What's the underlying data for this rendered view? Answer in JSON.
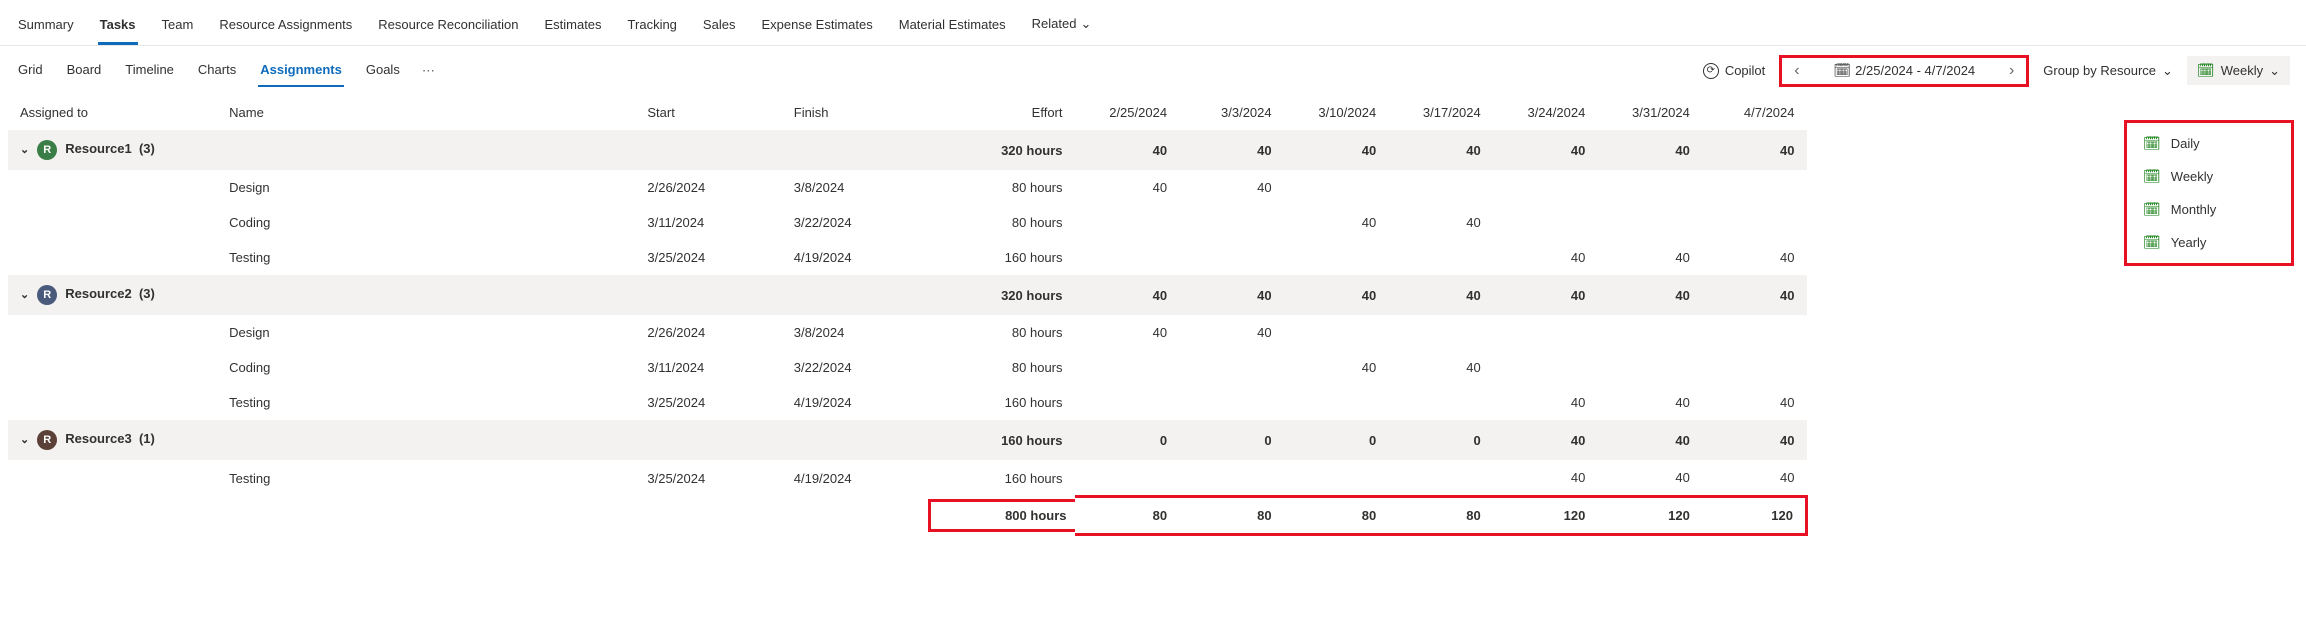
{
  "mainTabs": {
    "t0": "Summary",
    "t1": "Tasks",
    "t2": "Team",
    "t3": "Resource Assignments",
    "t4": "Resource Reconciliation",
    "t5": "Estimates",
    "t6": "Tracking",
    "t7": "Sales",
    "t8": "Expense Estimates",
    "t9": "Material Estimates",
    "t10": "Related"
  },
  "subTabs": {
    "s0": "Grid",
    "s1": "Board",
    "s2": "Timeline",
    "s3": "Charts",
    "s4": "Assignments",
    "s5": "Goals"
  },
  "toolbar": {
    "copilot": "Copilot",
    "dateRange": "2/25/2024 - 4/7/2024",
    "groupBy": "Group by Resource",
    "timescale": "Weekly"
  },
  "timescaleMenu": {
    "m0": "Daily",
    "m1": "Weekly",
    "m2": "Monthly",
    "m3": "Yearly"
  },
  "columns": {
    "assigned": "Assigned to",
    "name": "Name",
    "start": "Start",
    "finish": "Finish",
    "effort": "Effort",
    "w0": "2/25/2024",
    "w1": "3/3/2024",
    "w2": "3/10/2024",
    "w3": "3/17/2024",
    "w4": "3/24/2024",
    "w5": "3/31/2024",
    "w6": "4/7/2024"
  },
  "groups": [
    {
      "id": "r1",
      "label": "Resource1",
      "count": "(3)",
      "avatar": "R",
      "avatarClass": "av-green",
      "effort": "320 hours",
      "wk": [
        "40",
        "40",
        "40",
        "40",
        "40",
        "40",
        "40"
      ],
      "tasks": [
        {
          "name": "Design",
          "start": "2/26/2024",
          "finish": "3/8/2024",
          "effort": "80 hours",
          "wk": [
            "40",
            "40",
            "",
            "",
            "",
            "",
            ""
          ]
        },
        {
          "name": "Coding",
          "start": "3/11/2024",
          "finish": "3/22/2024",
          "effort": "80 hours",
          "wk": [
            "",
            "",
            "40",
            "40",
            "",
            "",
            ""
          ]
        },
        {
          "name": "Testing",
          "start": "3/25/2024",
          "finish": "4/19/2024",
          "effort": "160 hours",
          "wk": [
            "",
            "",
            "",
            "",
            "40",
            "40",
            "40"
          ]
        }
      ]
    },
    {
      "id": "r2",
      "label": "Resource2",
      "count": "(3)",
      "avatar": "R",
      "avatarClass": "av-blue",
      "effort": "320 hours",
      "wk": [
        "40",
        "40",
        "40",
        "40",
        "40",
        "40",
        "40"
      ],
      "tasks": [
        {
          "name": "Design",
          "start": "2/26/2024",
          "finish": "3/8/2024",
          "effort": "80 hours",
          "wk": [
            "40",
            "40",
            "",
            "",
            "",
            "",
            ""
          ]
        },
        {
          "name": "Coding",
          "start": "3/11/2024",
          "finish": "3/22/2024",
          "effort": "80 hours",
          "wk": [
            "",
            "",
            "40",
            "40",
            "",
            "",
            ""
          ]
        },
        {
          "name": "Testing",
          "start": "3/25/2024",
          "finish": "4/19/2024",
          "effort": "160 hours",
          "wk": [
            "",
            "",
            "",
            "",
            "40",
            "40",
            "40"
          ]
        }
      ]
    },
    {
      "id": "r3",
      "label": "Resource3",
      "count": "(1)",
      "avatar": "R",
      "avatarClass": "av-brown",
      "effort": "160 hours",
      "wk": [
        "0",
        "0",
        "0",
        "0",
        "40",
        "40",
        "40"
      ],
      "tasks": [
        {
          "name": "Testing",
          "start": "3/25/2024",
          "finish": "4/19/2024",
          "effort": "160 hours",
          "wk": [
            "",
            "",
            "",
            "",
            "40",
            "40",
            "40"
          ]
        }
      ]
    }
  ],
  "totals": {
    "effort": "800 hours",
    "wk": [
      "80",
      "80",
      "80",
      "80",
      "120",
      "120",
      "120"
    ]
  }
}
